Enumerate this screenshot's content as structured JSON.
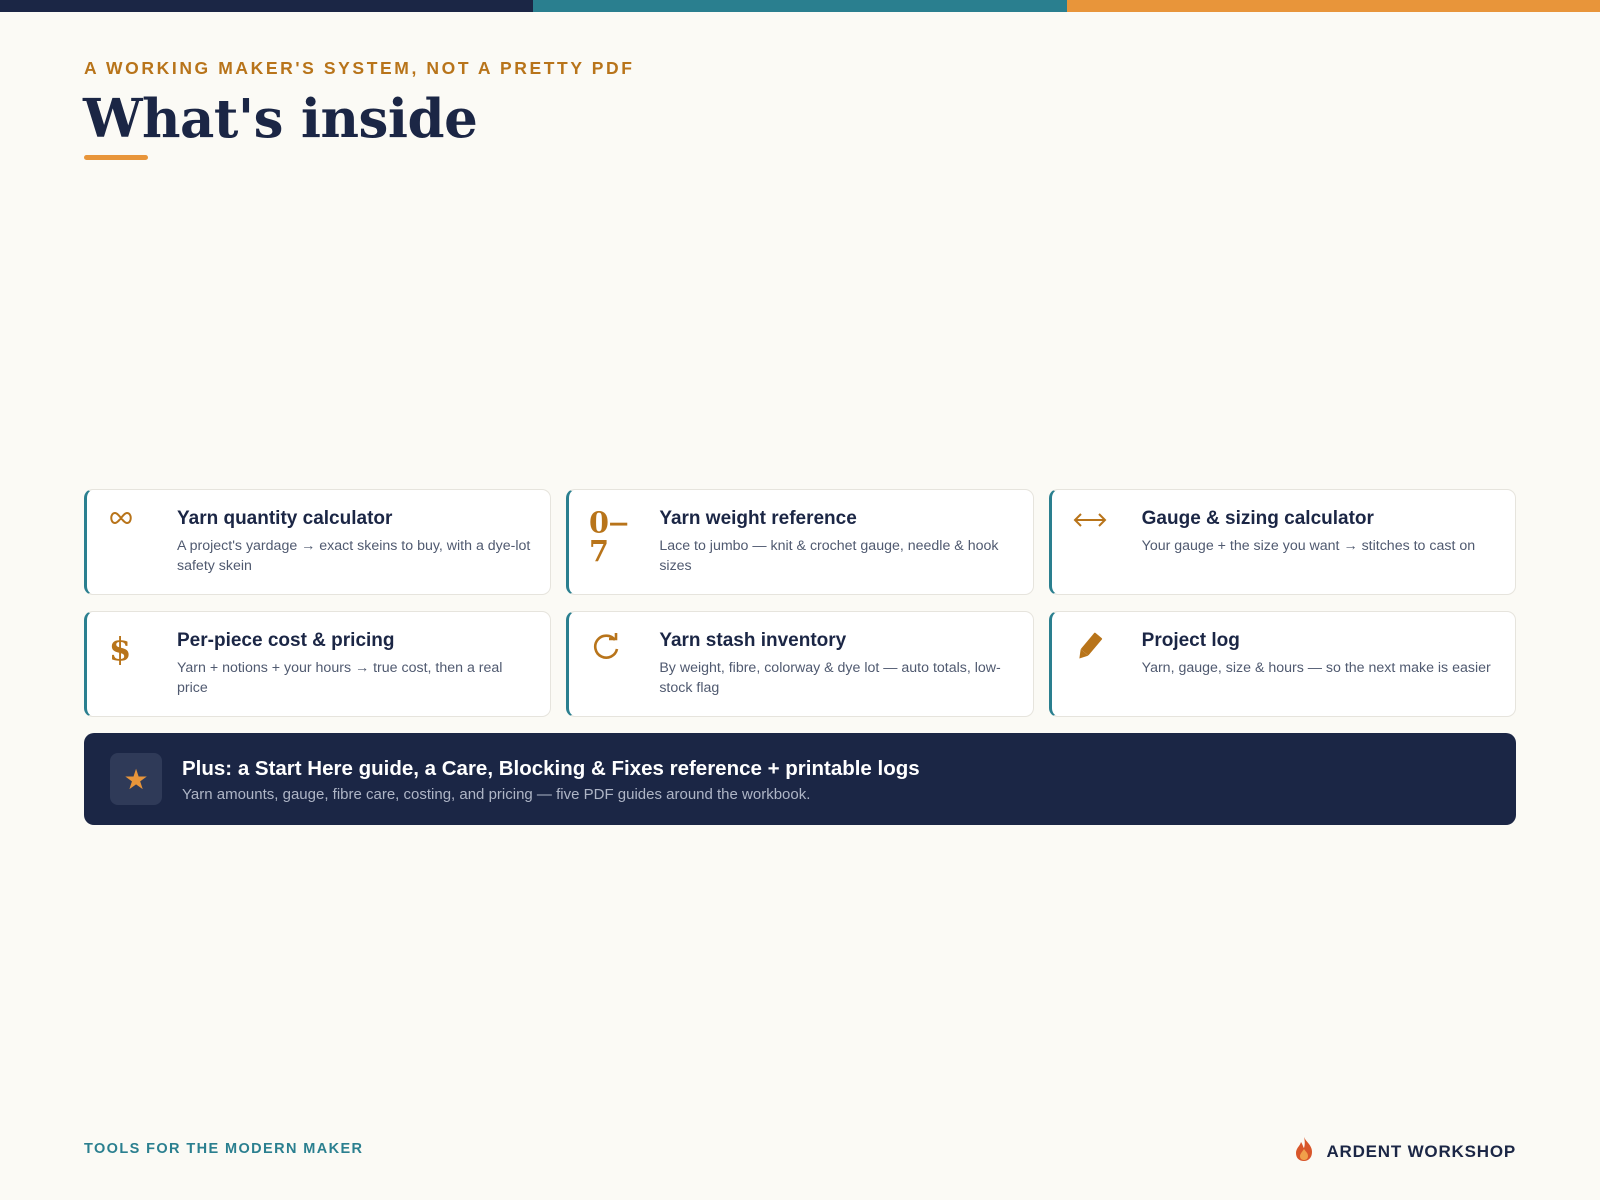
{
  "colors": {
    "navy": "#1b2645",
    "teal": "#2a7f8f",
    "orange": "#e8953a",
    "amber_text": "#b8741a",
    "background": "#fbfaf5"
  },
  "header": {
    "eyebrow": "A WORKING MAKER'S SYSTEM, NOT A PRETTY PDF",
    "title": "What's inside"
  },
  "features": [
    {
      "icon": "infinity-icon",
      "icon_glyph": "∞",
      "title": "Yarn quantity calculator",
      "description": "A project's yardage → exact skeins to buy, with a dye-lot safety skein"
    },
    {
      "icon": "weight-scale-icon",
      "icon_glyph": "0–7",
      "title": "Yarn weight reference",
      "description": "Lace to jumbo — knit & crochet gauge, needle & hook sizes"
    },
    {
      "icon": "double-arrow-icon",
      "icon_glyph": "⟷",
      "title": "Gauge & sizing calculator",
      "description": "Your gauge + the size you want → stitches to cast on"
    },
    {
      "icon": "dollar-icon",
      "icon_glyph": "$",
      "title": "Per-piece cost & pricing",
      "description": "Yarn + notions + your hours → true cost, then a real price"
    },
    {
      "icon": "refresh-icon",
      "icon_glyph": "⟳",
      "title": "Yarn stash inventory",
      "description": "By weight, fibre, colorway & dye lot — auto totals, low-stock flag"
    },
    {
      "icon": "pencil-icon",
      "icon_glyph": "✎",
      "title": "Project log",
      "description": "Yarn, gauge, size & hours — so the next make is easier"
    }
  ],
  "plus": {
    "icon": "star-icon",
    "headline": "Plus: a Start Here guide, a Care, Blocking & Fixes reference + printable logs",
    "subtext": "Yarn amounts, gauge, fibre care, costing, and pricing — five PDF guides around the workbook."
  },
  "footer": {
    "tagline": "TOOLS FOR THE MODERN MAKER",
    "brand": "ARDENT WORKSHOP",
    "brand_icon": "flame-icon"
  }
}
